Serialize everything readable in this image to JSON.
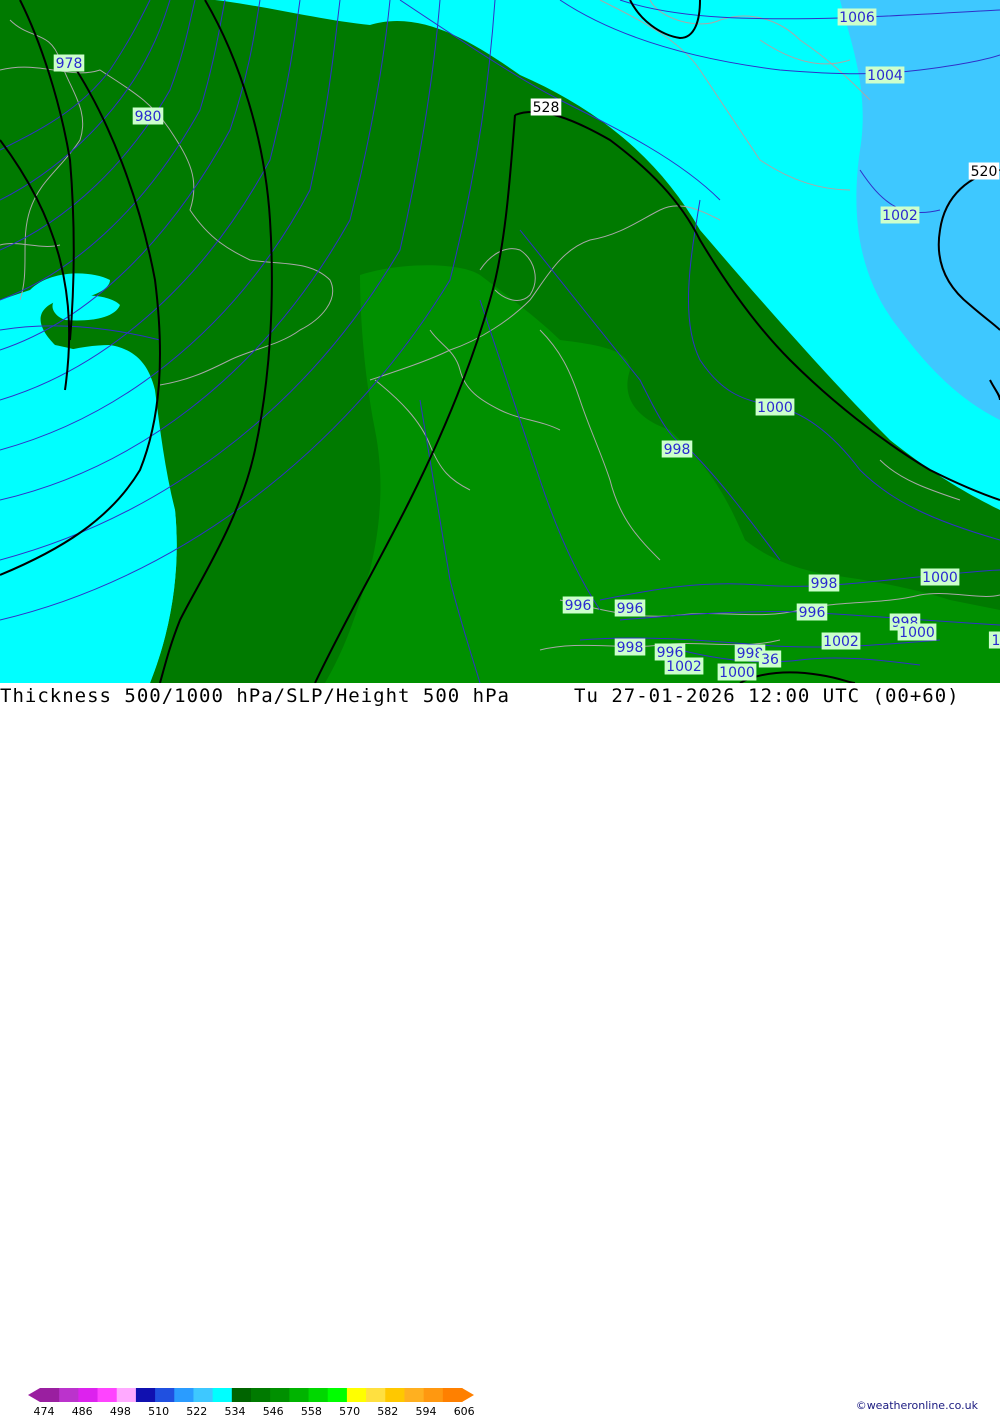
{
  "map": {
    "isobar_labels": [
      {
        "id": "p978",
        "text": "978",
        "kind": "slp"
      },
      {
        "id": "p980",
        "text": "980",
        "kind": "slp"
      },
      {
        "id": "p1006",
        "text": "1006",
        "kind": "slp"
      },
      {
        "id": "p1004",
        "text": "1004",
        "kind": "slp"
      },
      {
        "id": "p1002a",
        "text": "1002",
        "kind": "slp"
      },
      {
        "id": "p1000a",
        "text": "1000",
        "kind": "slp"
      },
      {
        "id": "p998a",
        "text": "998",
        "kind": "slp"
      },
      {
        "id": "p998b",
        "text": "998",
        "kind": "slp"
      },
      {
        "id": "p1000b",
        "text": "1000",
        "kind": "slp"
      },
      {
        "id": "p996a",
        "text": "996",
        "kind": "slp"
      },
      {
        "id": "p996b",
        "text": "996",
        "kind": "slp"
      },
      {
        "id": "p996c",
        "text": "996",
        "kind": "slp"
      },
      {
        "id": "p998c",
        "text": "998",
        "kind": "slp"
      },
      {
        "id": "p1002b",
        "text": "1002",
        "kind": "slp"
      },
      {
        "id": "p998d",
        "text": "998",
        "kind": "slp"
      },
      {
        "id": "p996d",
        "text": "996",
        "kind": "slp"
      },
      {
        "id": "p998e",
        "text": "998",
        "kind": "slp"
      },
      {
        "id": "p1000c",
        "text": "1000",
        "kind": "slp"
      },
      {
        "id": "p1000d",
        "text": "1000",
        "kind": "slp"
      },
      {
        "id": "p1002c",
        "text": "1002",
        "kind": "slp"
      },
      {
        "id": "p998f",
        "text": "998",
        "kind": "slp"
      },
      {
        "id": "p36",
        "text": "36",
        "kind": "slp"
      },
      {
        "id": "p1edge",
        "text": "1",
        "kind": "slp"
      },
      {
        "id": "h528",
        "text": "528",
        "kind": "height"
      },
      {
        "id": "h520",
        "text": "520",
        "kind": "height"
      }
    ],
    "colors": {
      "band_510_522": "#2a9cff",
      "band_516_522": "#3ec8ff",
      "band_522_534": "#00ffff",
      "band_534_540": "#00a000",
      "band_540_546": "#007a00",
      "land_border": "#a8a8a8",
      "isobar": "#3030c8",
      "height_contour": "#000000"
    }
  },
  "footer": {
    "title_left": "Thickness 500/1000 hPa/SLP/Height 500 hPa",
    "title_right": "Tu 27-01-2026 12:00 UTC (00+60)",
    "credit": "©weatheronline.co.uk",
    "legend": {
      "ticks": [
        "474",
        "486",
        "498",
        "510",
        "522",
        "534",
        "546",
        "558",
        "570",
        "582",
        "594",
        "606"
      ],
      "colors": [
        "#9a1fa0",
        "#bb33cc",
        "#dd22ee",
        "#ff44ff",
        "#ffaaff",
        "#1010b0",
        "#2050e0",
        "#2a9cff",
        "#3ec8ff",
        "#00ffff",
        "#006400",
        "#007a00",
        "#009000",
        "#00b400",
        "#00d800",
        "#00ff00",
        "#ffff00",
        "#ffe040",
        "#ffc800",
        "#ffb020",
        "#ff9810",
        "#ff8000"
      ]
    }
  }
}
